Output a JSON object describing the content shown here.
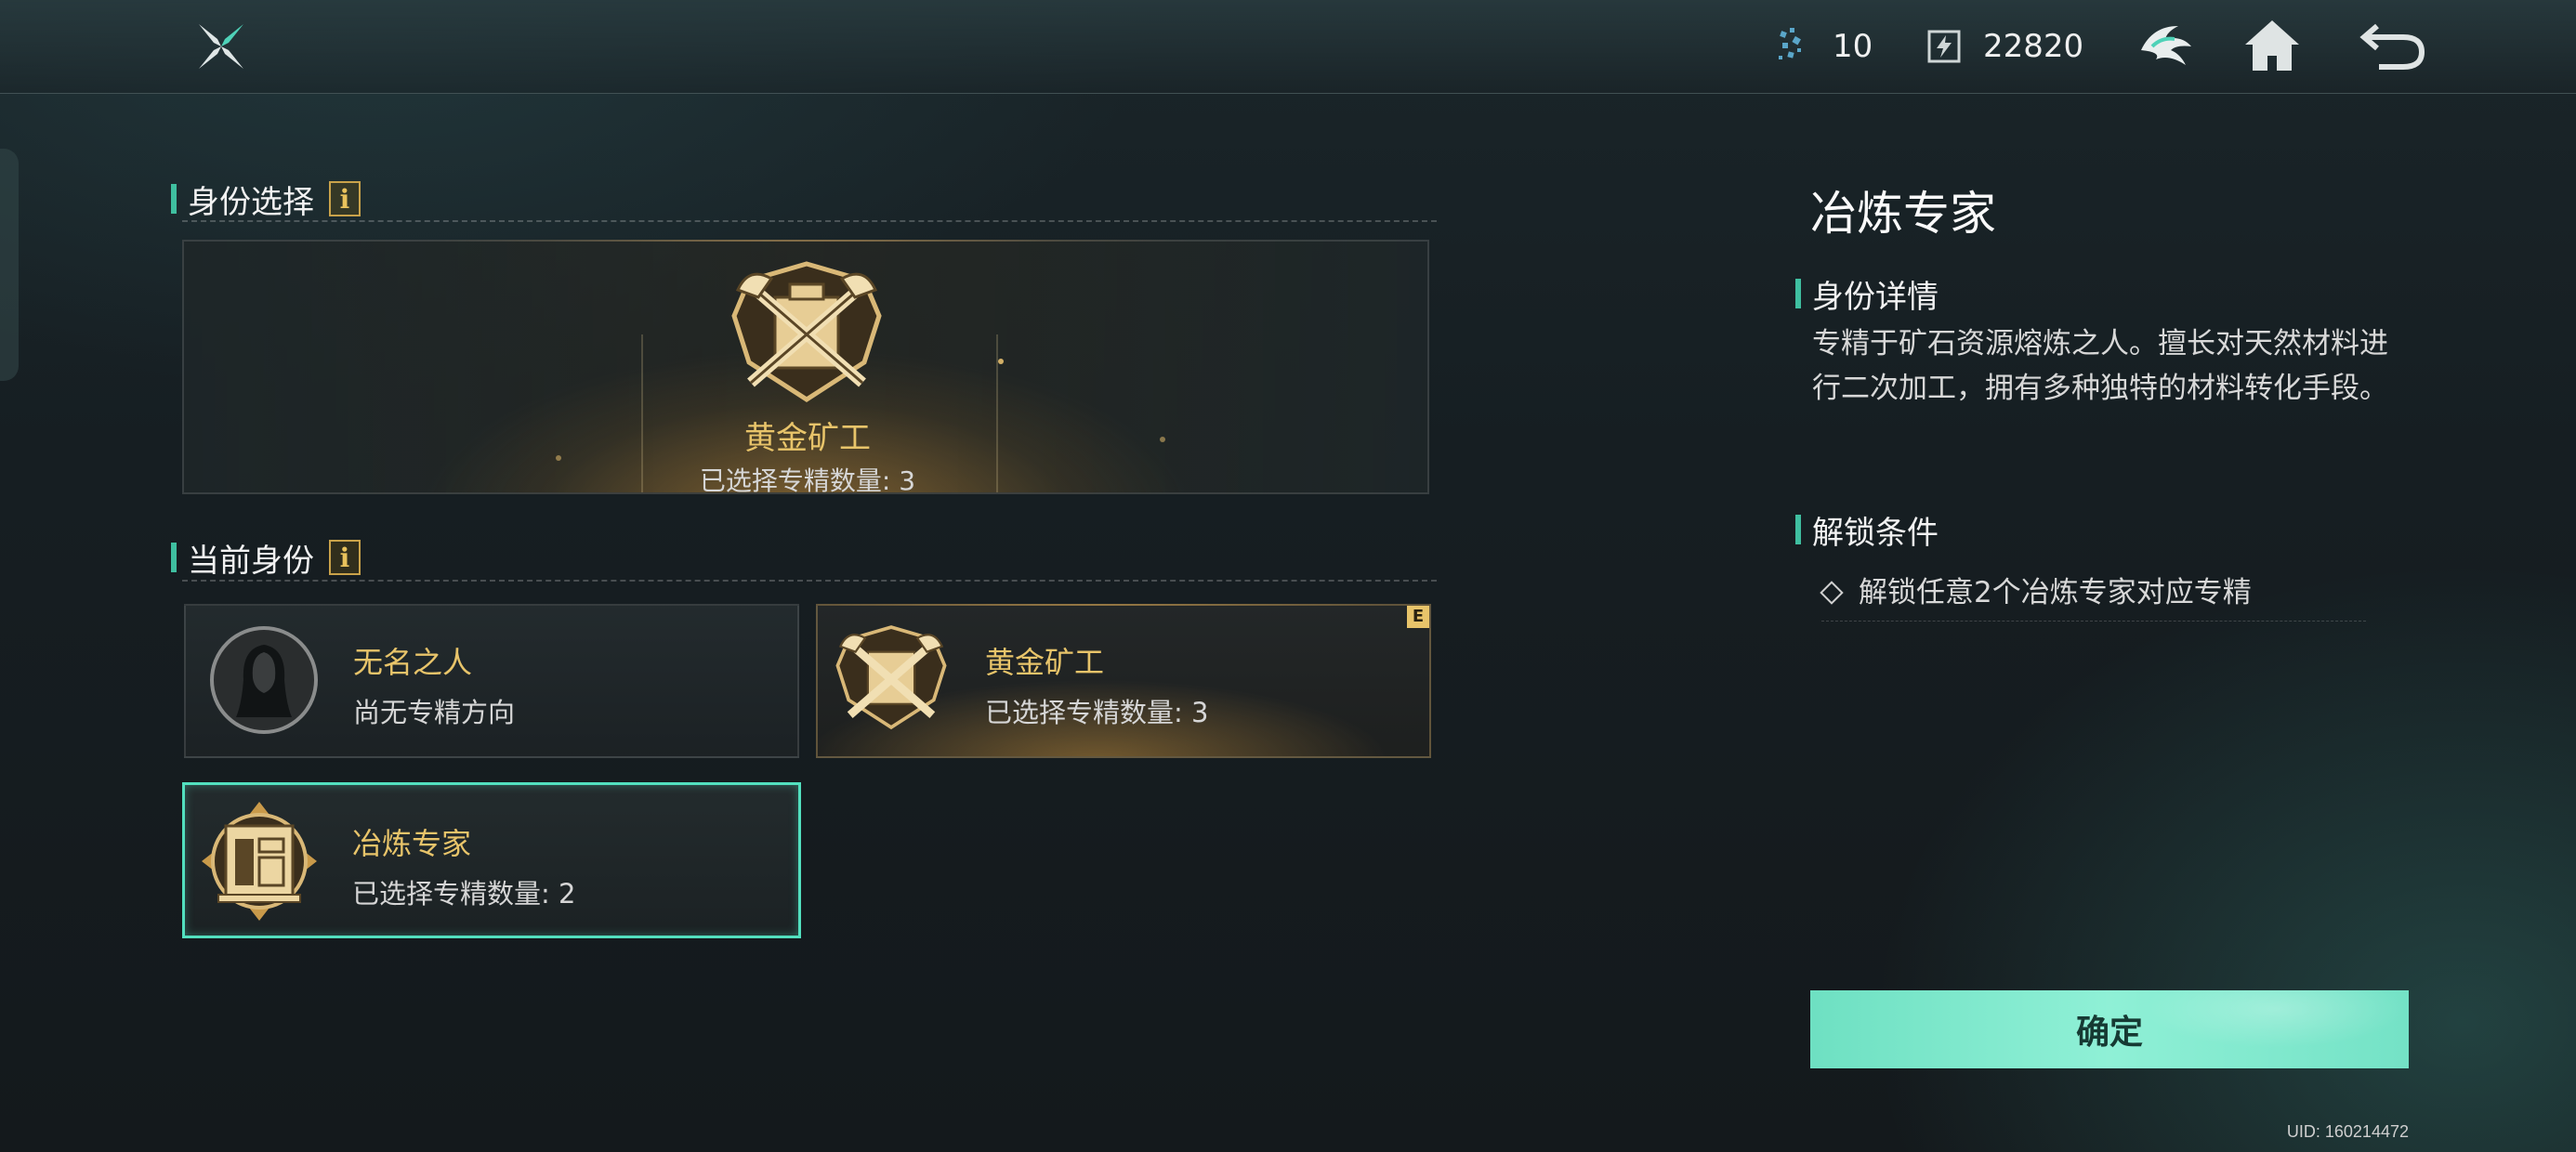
{
  "topbar": {
    "energy_count": "10",
    "currency_amount": "22820",
    "icons": [
      "logo-icon",
      "energy-icon",
      "currency-icon",
      "faction-icon",
      "home-icon",
      "back-icon"
    ]
  },
  "identity_select": {
    "title": "身份选择",
    "info": "i",
    "banner_name": "黄金矿工",
    "banner_sub": "已选择专精数量: 3"
  },
  "current_identity": {
    "title": "当前身份",
    "info": "i",
    "cards": [
      {
        "name": "无名之人",
        "sub": "尚无专精方向"
      },
      {
        "name": "黄金矿工",
        "sub": "已选择专精数量: 3",
        "tag": "E"
      },
      {
        "name": "冶炼专家",
        "sub": "已选择专精数量: 2"
      }
    ]
  },
  "detail": {
    "title": "冶炼专家",
    "info_header": "身份详情",
    "description": "专精于矿石资源熔炼之人。擅长对天然材料进行二次加工，拥有多种独特的材料转化手段。",
    "unlock_header": "解锁条件",
    "unlock_item": "解锁任意2个冶炼专家对应专精"
  },
  "confirm_label": "确定",
  "uid": "UID: 160214472",
  "colors": {
    "accent": "#52e0bf",
    "gold": "#e8c46a",
    "button": "#7fe8cc"
  }
}
